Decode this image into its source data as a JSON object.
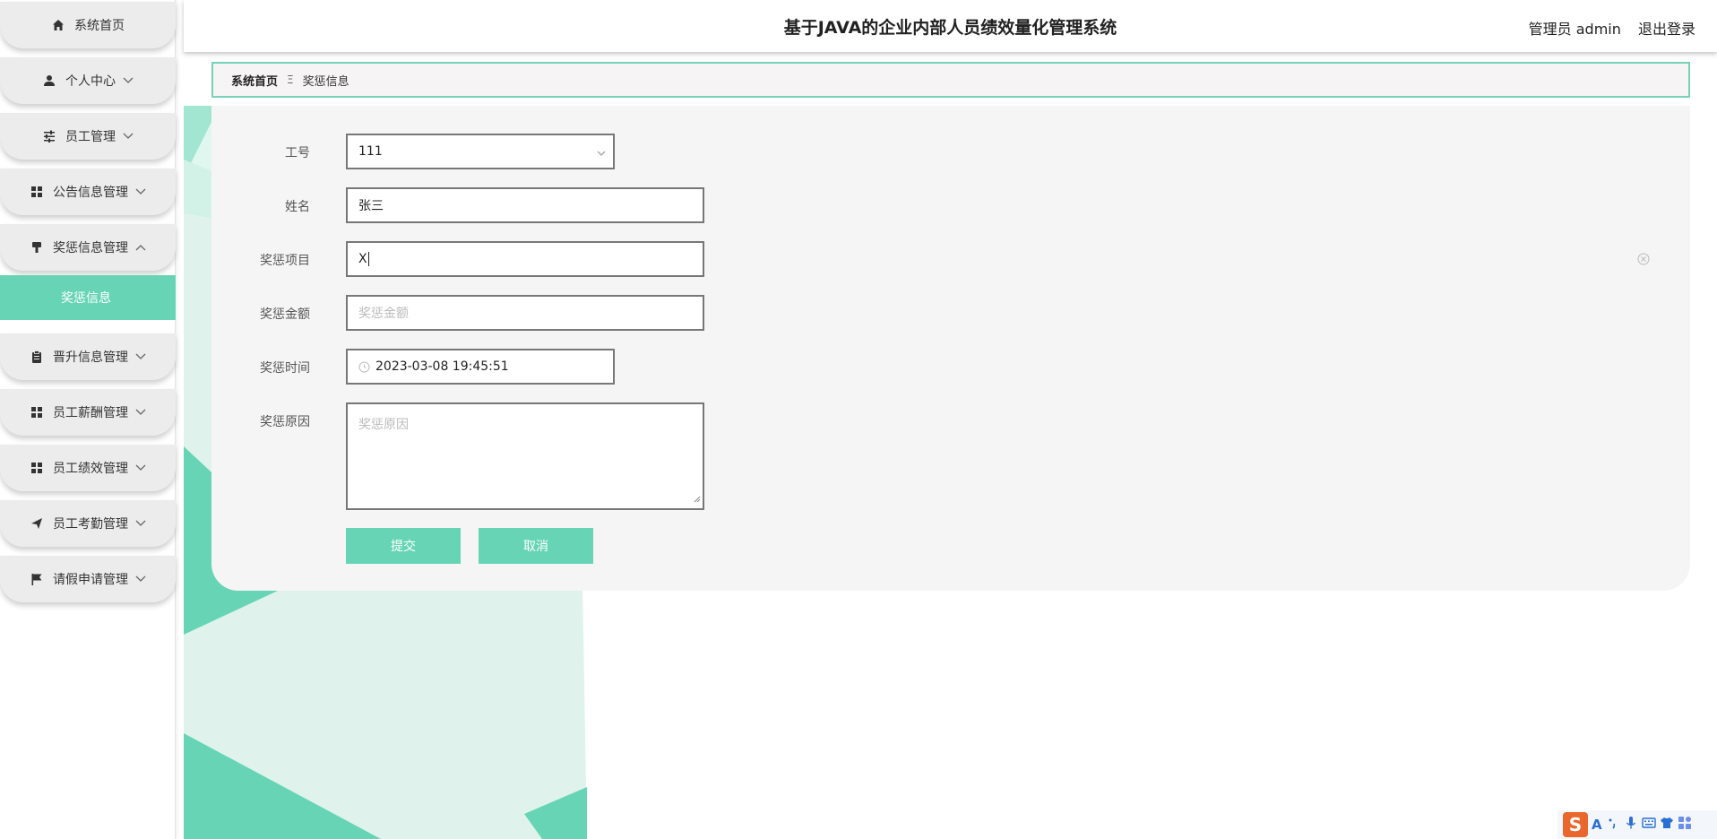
{
  "header": {
    "title": "基于JAVA的企业内部人员绩效量化管理系统",
    "user_label": "管理员 admin",
    "logout_label": "退出登录"
  },
  "sidebar": {
    "items": [
      {
        "label": "系统首页",
        "icon": "home-icon"
      },
      {
        "label": "个人中心",
        "icon": "person-icon",
        "chevron": "down"
      },
      {
        "label": "员工管理",
        "icon": "sliders-icon",
        "chevron": "down"
      },
      {
        "label": "公告信息管理",
        "icon": "grid-icon",
        "chevron": "down"
      },
      {
        "label": "奖惩信息管理",
        "icon": "brush-icon",
        "chevron": "up"
      },
      {
        "label": "晋升信息管理",
        "icon": "clipboard-icon",
        "chevron": "down"
      },
      {
        "label": "员工薪酬管理",
        "icon": "grid-icon",
        "chevron": "down"
      },
      {
        "label": "员工绩效管理",
        "icon": "grid-icon",
        "chevron": "down"
      },
      {
        "label": "员工考勤管理",
        "icon": "send-icon",
        "chevron": "down"
      },
      {
        "label": "请假申请管理",
        "icon": "flag-icon",
        "chevron": "down"
      }
    ],
    "active_sub": "奖惩信息"
  },
  "breadcrumb": {
    "home": "系统首页",
    "separator": "Ξ",
    "current": "奖惩信息"
  },
  "form": {
    "gonghao": {
      "label": "工号",
      "value": "111"
    },
    "name": {
      "label": "姓名",
      "value": "张三"
    },
    "project": {
      "label": "奖惩项目",
      "value": "X"
    },
    "amount": {
      "label": "奖惩金额",
      "placeholder": "奖惩金额"
    },
    "time": {
      "label": "奖惩时间",
      "value": "2023-03-08 19:45:51"
    },
    "reason": {
      "label": "奖惩原因",
      "placeholder": "奖惩原因"
    },
    "submit_label": "提交",
    "cancel_label": "取消"
  },
  "colors": {
    "accent": "#67d5b5",
    "menu_bg": "#ececec",
    "card_bg": "#f6f5f5"
  },
  "ime": {
    "logo": "S",
    "mode": "A"
  }
}
